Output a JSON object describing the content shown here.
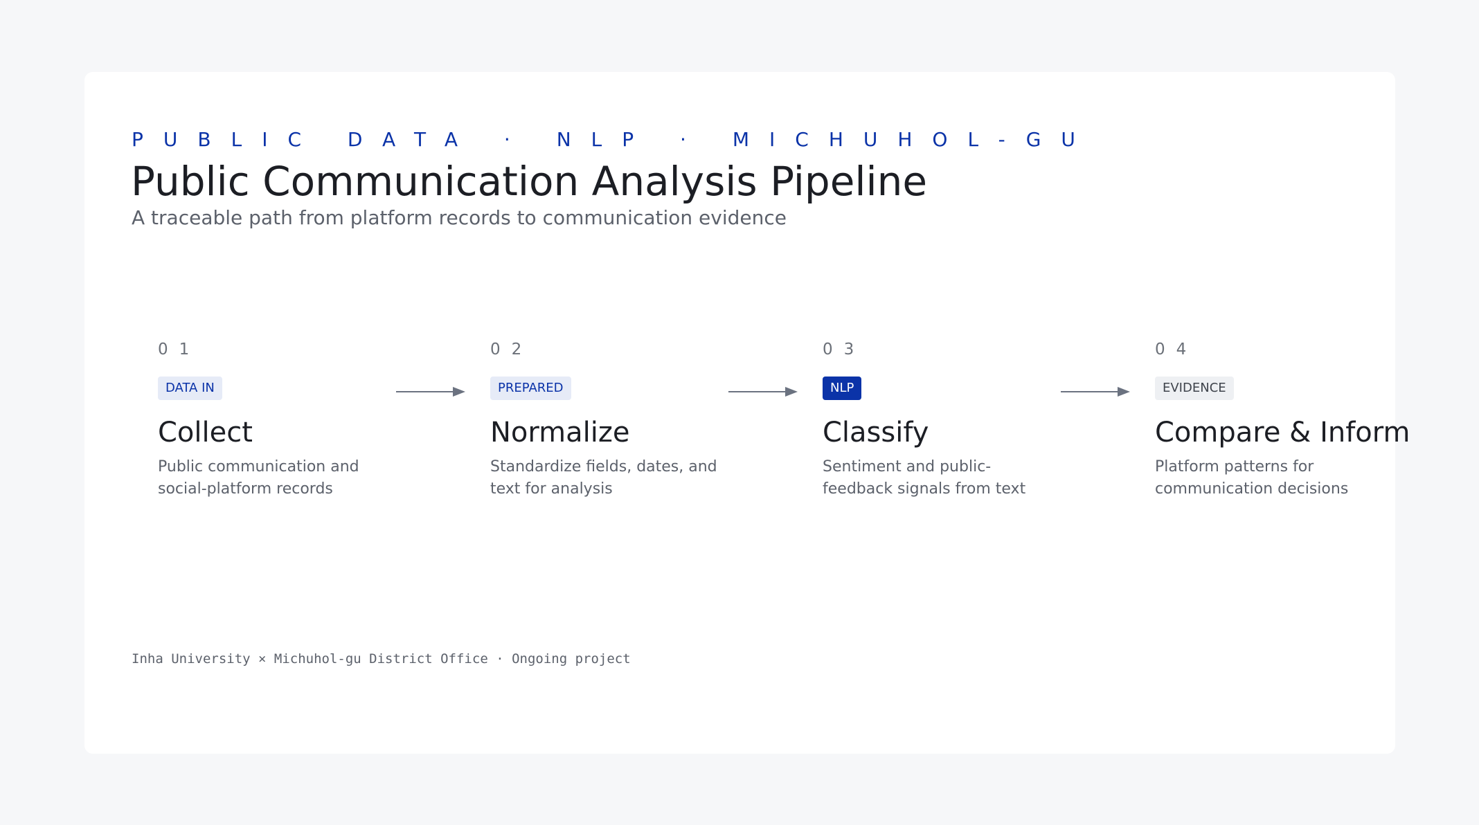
{
  "header": {
    "eyebrow": "PUBLIC DATA · NLP · MICHUHOL-GU",
    "title": "Public Communication Analysis Pipeline",
    "subtitle": "A traceable path from platform records to communication evidence"
  },
  "steps": [
    {
      "number": "01",
      "tag": "DATA IN",
      "title": "Collect",
      "description": "Public communication and social-platform records"
    },
    {
      "number": "02",
      "tag": "PREPARED",
      "title": "Normalize",
      "description": "Standardize fields, dates, and text for analysis"
    },
    {
      "number": "03",
      "tag": "NLP",
      "title": "Classify",
      "description": "Sentiment and public-feedback signals from text"
    },
    {
      "number": "04",
      "tag": "EVIDENCE",
      "title": "Compare & Inform",
      "description": "Platform patterns for communication decisions"
    }
  ],
  "footer": {
    "text": "Inha University × Michuhol-gu District Office · Ongoing project"
  },
  "colors": {
    "accent": "#0b33a8",
    "tag_light_bg": "#e6ebf7",
    "tag_grey_bg": "#eef0f3",
    "arrow": "#6b7280",
    "background": "#f6f7f9",
    "card": "#ffffff"
  },
  "icons": [
    "arrow-right-icon"
  ]
}
